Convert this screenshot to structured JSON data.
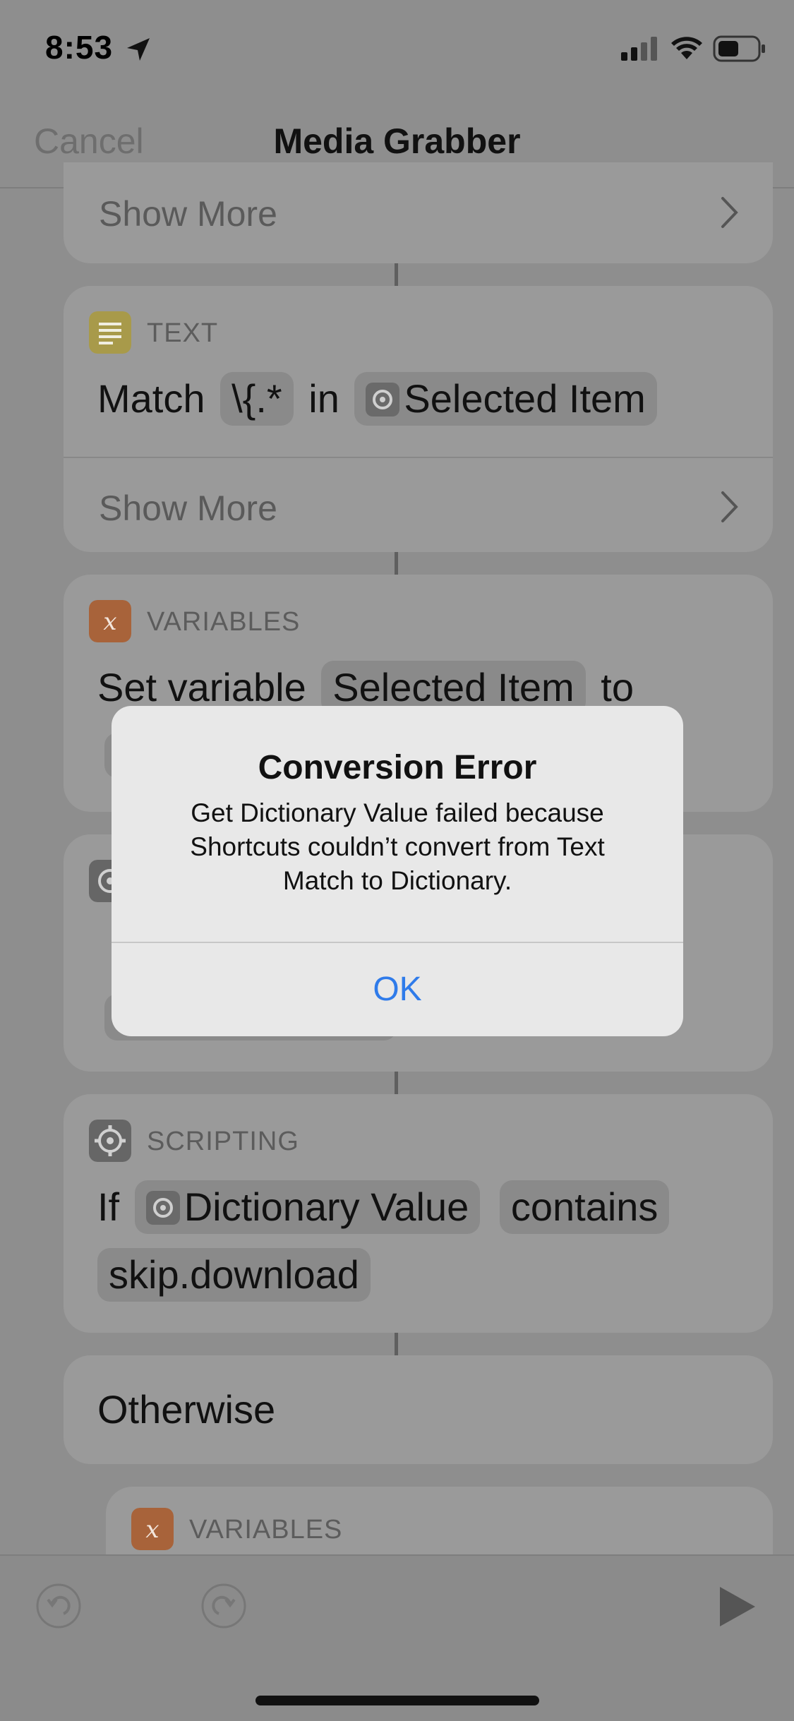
{
  "status_bar": {
    "time": "8:53"
  },
  "nav": {
    "cancel_label": "Cancel",
    "title": "Media Grabber"
  },
  "cards": {
    "show_more_label": "Show More",
    "text_action": {
      "category": "TEXT",
      "verb": "Match",
      "pattern": "\\{.*",
      "in_word": "in",
      "input": "Selected Item"
    },
    "variables_action": {
      "category": "VARIABLES",
      "verb": "Set variable",
      "variable": "Selected Item",
      "to_word": "to"
    },
    "scripting_action": {
      "category": "SCRIPTING",
      "if_word": "If",
      "input": "Dictionary Value",
      "condition": "contains",
      "value": "skip.download"
    },
    "otherwise_label": "Otherwise",
    "variables_action_2": {
      "category": "VARIABLES"
    }
  },
  "alert": {
    "title": "Conversion Error",
    "message": "Get Dictionary Value failed because Shortcuts couldn’t convert from Text Match to Dictionary.",
    "ok_label": "OK",
    "ok_color": "#2f7bea"
  }
}
